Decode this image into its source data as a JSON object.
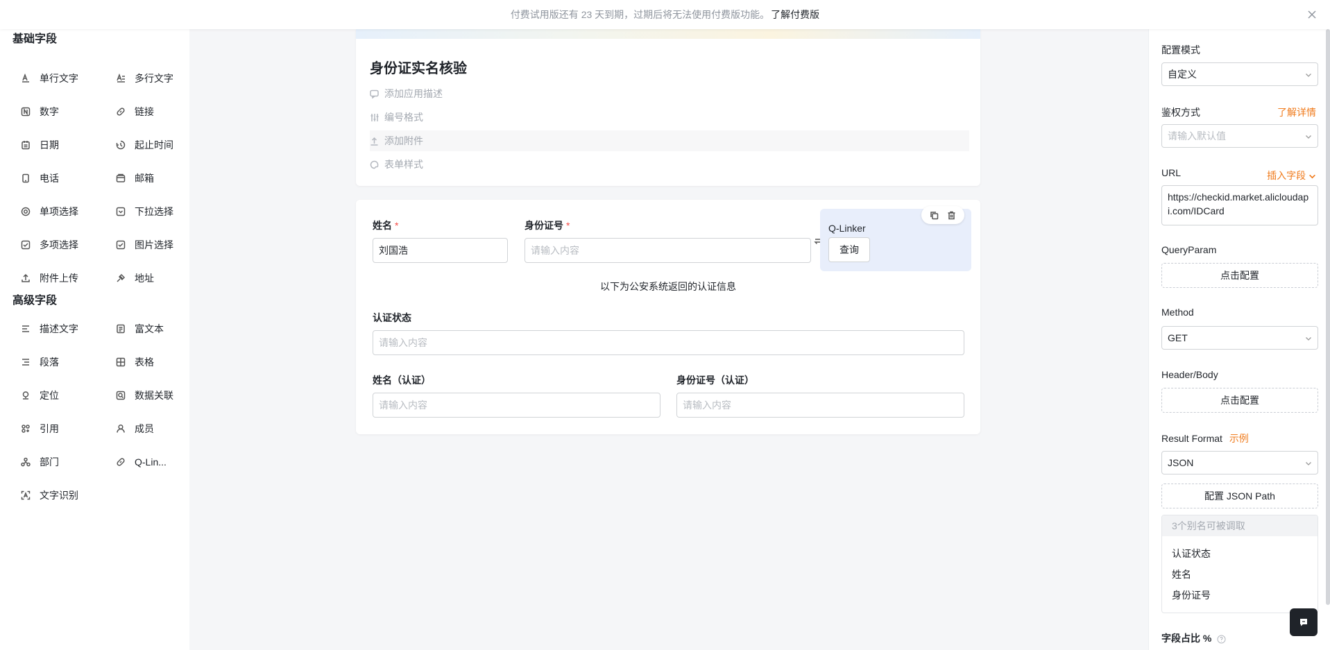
{
  "banner": {
    "text": "付费试用版还有 23 天到期，过期后将无法使用付费版功能。",
    "link": "了解付费版"
  },
  "left": {
    "basic_title": "基础字段",
    "advanced_title": "高级字段",
    "basic_fields": [
      {
        "label": "单行文字",
        "icon": "single-line-text-icon"
      },
      {
        "label": "多行文字",
        "icon": "multi-line-text-icon"
      },
      {
        "label": "数字",
        "icon": "number-icon"
      },
      {
        "label": "链接",
        "icon": "link-icon"
      },
      {
        "label": "日期",
        "icon": "date-icon"
      },
      {
        "label": "起止时间",
        "icon": "time-range-icon"
      },
      {
        "label": "电话",
        "icon": "phone-icon"
      },
      {
        "label": "邮箱",
        "icon": "email-icon"
      },
      {
        "label": "单项选择",
        "icon": "radio-icon"
      },
      {
        "label": "下拉选择",
        "icon": "dropdown-icon"
      },
      {
        "label": "多项选择",
        "icon": "checkbox-icon"
      },
      {
        "label": "图片选择",
        "icon": "image-select-icon"
      },
      {
        "label": "附件上传",
        "icon": "upload-icon"
      },
      {
        "label": "地址",
        "icon": "address-icon"
      }
    ],
    "advanced_fields": [
      {
        "label": "描述文字",
        "icon": "description-icon"
      },
      {
        "label": "富文本",
        "icon": "rich-text-icon"
      },
      {
        "label": "段落",
        "icon": "paragraph-icon"
      },
      {
        "label": "表格",
        "icon": "table-icon"
      },
      {
        "label": "定位",
        "icon": "location-icon"
      },
      {
        "label": "数据关联",
        "icon": "data-link-icon"
      },
      {
        "label": "引用",
        "icon": "reference-icon"
      },
      {
        "label": "成员",
        "icon": "member-icon"
      },
      {
        "label": "部门",
        "icon": "department-icon"
      },
      {
        "label": "Q-Lin...",
        "icon": "q-linker-icon"
      },
      {
        "label": "文字识别",
        "icon": "ocr-icon"
      }
    ]
  },
  "form": {
    "title": "身份证实名核验",
    "add_description": "添加应用描述",
    "number_format": "编号格式",
    "add_attachment": "添加附件",
    "form_style": "表单样式"
  },
  "fields": {
    "name_label": "姓名",
    "name_value": "刘国浩",
    "id_label": "身份证号",
    "required_mark": "*",
    "id_placeholder": "请输入内容",
    "qlinker_name": "Q-Linker",
    "query_button": "查询",
    "info_text": "以下为公安系统返回的认证信息",
    "status_label": "认证状态",
    "status_placeholder": "请输入内容",
    "name_verified_label": "姓名（认证）",
    "name_verified_placeholder": "请输入内容",
    "id_verified_label": "身份证号（认证）",
    "id_verified_placeholder": "请输入内容"
  },
  "right": {
    "config_mode_label": "配置模式",
    "config_mode_value": "自定义",
    "auth_label": "鉴权方式",
    "auth_link": "了解详情",
    "auth_placeholder": "请输入默认值",
    "url_label": "URL",
    "insert_field": "插入字段",
    "url_value": "https://checkid.market.alicloudapi.com/IDCard",
    "queryparam_label": "QueryParam",
    "click_config": "点击配置",
    "method_label": "Method",
    "method_value": "GET",
    "header_label": "Header/Body",
    "header_config": "点击配置",
    "result_format_label": "Result Format",
    "example_link": "示例",
    "result_format_value": "JSON",
    "json_path_button": "配置 JSON Path",
    "alias_header": "3个别名可被调取",
    "aliases": [
      "认证状态",
      "姓名",
      "身份证号"
    ],
    "field_ratio_label": "字段占比 %"
  },
  "colors": {
    "accent": "#f07b1c",
    "required": "#f54a45",
    "qlinker_bg": "#e8eefb"
  }
}
